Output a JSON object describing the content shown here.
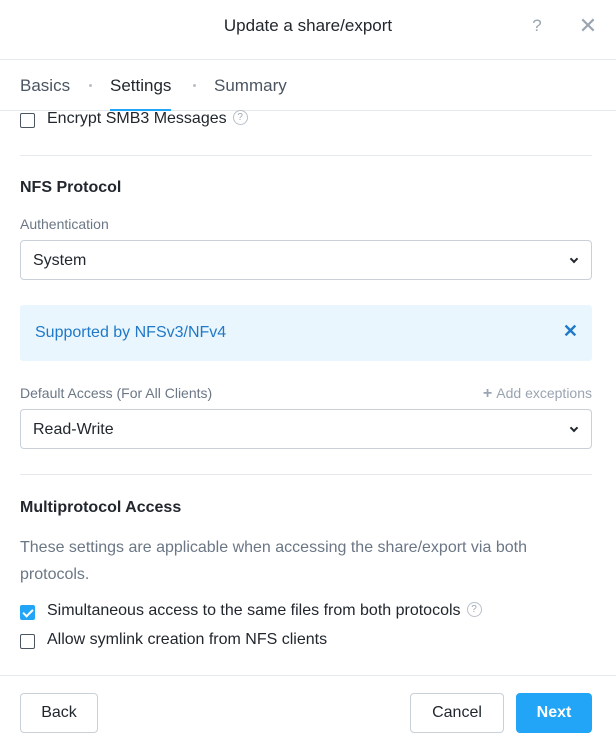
{
  "header": {
    "title": "Update a share/export",
    "help_glyph": "?",
    "close_glyph": "✕"
  },
  "tabs": [
    {
      "label": "Basics",
      "active": false
    },
    {
      "label": "Settings",
      "active": true
    },
    {
      "label": "Summary",
      "active": false
    }
  ],
  "smb": {
    "encrypt_label": "Encrypt SMB3 Messages",
    "encrypt_checked": false
  },
  "nfs": {
    "section_title": "NFS Protocol",
    "auth_label": "Authentication",
    "auth_value": "System",
    "banner_text": "Supported by NFSv3/NFv4",
    "default_access_label": "Default Access (For All Clients)",
    "add_exceptions_label": "Add exceptions",
    "default_access_value": "Read-Write"
  },
  "multiprotocol": {
    "section_title": "Multiprotocol Access",
    "description": "These settings are applicable when accessing the share/export via both protocols.",
    "simultaneous_label": "Simultaneous access to the same files from both protocols",
    "simultaneous_checked": true,
    "symlink_label": "Allow symlink creation from NFS clients",
    "symlink_checked": false
  },
  "footer": {
    "back_label": "Back",
    "cancel_label": "Cancel",
    "next_label": "Next"
  },
  "colors": {
    "accent": "#22a5f7",
    "banner_bg": "#eaf6fd",
    "banner_text": "#1f79c8"
  },
  "icons": {
    "help": "question-mark-icon",
    "close": "close-icon",
    "info": "info-circle-icon",
    "chevron": "chevron-down-icon",
    "plus": "plus-icon"
  }
}
